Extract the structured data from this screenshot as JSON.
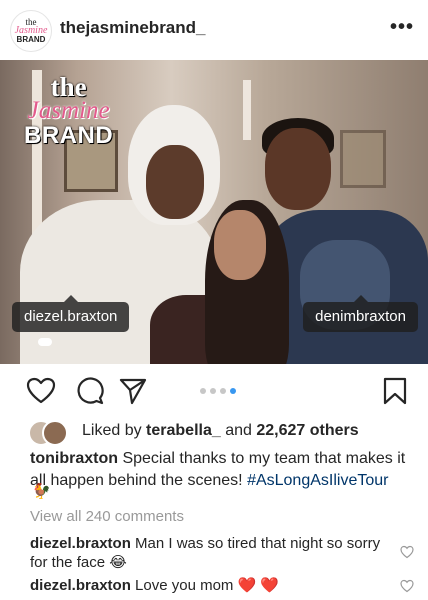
{
  "header": {
    "avatar_line1": "the",
    "avatar_line2": "Jasmine",
    "avatar_line3": "BRAND",
    "username": "thejasminebrand_",
    "more": "•••"
  },
  "photo": {
    "watermark_line1": "the",
    "watermark_line2": "Jasmine",
    "watermark_line3": "BRAND",
    "tag_left": "diezel.braxton",
    "tag_right": "denimbraxton"
  },
  "carousel": {
    "count": 4,
    "active_index": 3,
    "active_color": "#3897f0"
  },
  "likes": {
    "prefix": "Liked by ",
    "user": "terabella_",
    "middle": " and ",
    "count": "22,627 others"
  },
  "caption": {
    "user": "tonibraxton",
    "text": " Special thanks to my team that makes it all happen behind the scenes! ",
    "hashtag": "#AsLongAsIliveTour",
    "emoji": "🐓"
  },
  "view_all_comments": "View all 240 comments",
  "comments": [
    {
      "user": "diezel.braxton",
      "text": " Man I was so tired that night so sorry for the face 😂"
    },
    {
      "user": "diezel.braxton",
      "text": " Love you mom ",
      "emoji": "❤️ ❤️"
    }
  ],
  "colors": {
    "link": "#003569",
    "muted": "#999999",
    "text": "#262626",
    "brand_pink": "#e35a8c"
  },
  "icons": [
    "heart-icon",
    "comment-icon",
    "share-icon",
    "bookmark-icon",
    "comment-like-icon"
  ]
}
